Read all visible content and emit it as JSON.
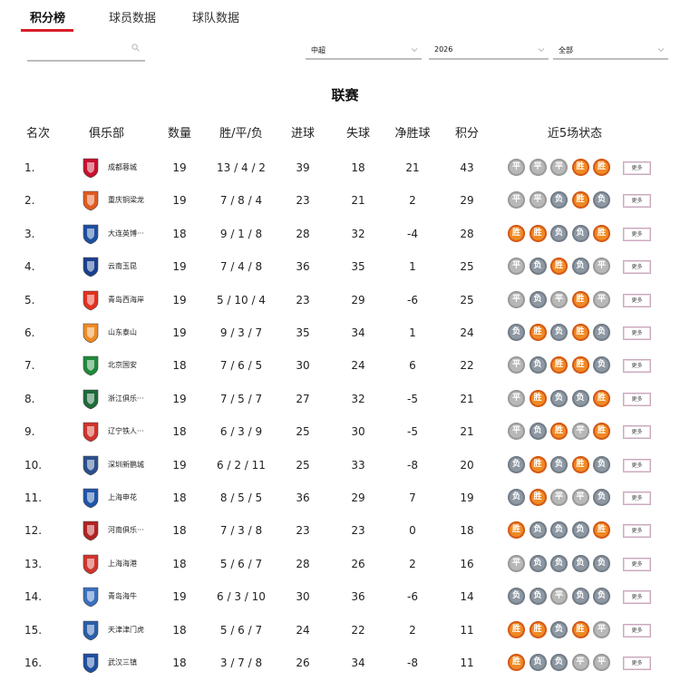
{
  "tabs": [
    {
      "label": "积分榜",
      "active": true
    },
    {
      "label": "球员数据",
      "active": false
    },
    {
      "label": "球队数据",
      "active": false
    }
  ],
  "search": {
    "placeholder": ""
  },
  "filters": {
    "league": "中超",
    "season": "2026",
    "scope": "全部"
  },
  "section_title": "联赛",
  "table": {
    "headers": [
      "名次",
      "俱乐部",
      "数量",
      "胜/平/负",
      "进球",
      "失球",
      "净胜球",
      "积分",
      "近5场状态"
    ],
    "more_label": "更多",
    "rows": [
      {
        "rank": "1.",
        "club": "成都蓉城",
        "games": "19",
        "wdl": "13 / 4 / 2",
        "gf": "39",
        "ga": "18",
        "gd": "21",
        "pts": "43",
        "form": [
          "平",
          "平",
          "平",
          "胜",
          "胜"
        ],
        "logo_color": "#c8102e"
      },
      {
        "rank": "2.",
        "club": "重庆铜梁龙",
        "games": "19",
        "wdl": "7 / 8 / 4",
        "gf": "23",
        "ga": "21",
        "gd": "2",
        "pts": "29",
        "form": [
          "平",
          "平",
          "负",
          "胜",
          "负"
        ],
        "logo_color": "#e05a1f"
      },
      {
        "rank": "3.",
        "club": "大连英博···",
        "games": "18",
        "wdl": "9 / 1 / 8",
        "gf": "28",
        "ga": "32",
        "gd": "-4",
        "pts": "28",
        "form": [
          "胜",
          "胜",
          "负",
          "负",
          "胜"
        ],
        "logo_color": "#1c4fa0"
      },
      {
        "rank": "4.",
        "club": "云南玉昆",
        "games": "19",
        "wdl": "7 / 4 / 8",
        "gf": "36",
        "ga": "35",
        "gd": "1",
        "pts": "25",
        "form": [
          "平",
          "负",
          "胜",
          "负",
          "平"
        ],
        "logo_color": "#1a3f8f"
      },
      {
        "rank": "5.",
        "club": "青岛西海岸",
        "games": "19",
        "wdl": "5 / 10 / 4",
        "gf": "23",
        "ga": "29",
        "gd": "-6",
        "pts": "25",
        "form": [
          "平",
          "负",
          "平",
          "胜",
          "平"
        ],
        "logo_color": "#e2321f"
      },
      {
        "rank": "6.",
        "club": "山东泰山",
        "games": "19",
        "wdl": "9 / 3 / 7",
        "gf": "35",
        "ga": "34",
        "gd": "1",
        "pts": "24",
        "form": [
          "负",
          "胜",
          "负",
          "胜",
          "负"
        ],
        "logo_color": "#f08a24"
      },
      {
        "rank": "7.",
        "club": "北京国安",
        "games": "18",
        "wdl": "7 / 6 / 5",
        "gf": "30",
        "ga": "24",
        "gd": "6",
        "pts": "22",
        "form": [
          "平",
          "负",
          "胜",
          "胜",
          "负"
        ],
        "logo_color": "#1f8a3a"
      },
      {
        "rank": "8.",
        "club": "浙江俱乐···",
        "games": "19",
        "wdl": "7 / 5 / 7",
        "gf": "27",
        "ga": "32",
        "gd": "-5",
        "pts": "21",
        "form": [
          "平",
          "胜",
          "负",
          "负",
          "胜"
        ],
        "logo_color": "#1e6b3a"
      },
      {
        "rank": "9.",
        "club": "辽宁铁人···",
        "games": "18",
        "wdl": "6 / 3 / 9",
        "gf": "25",
        "ga": "30",
        "gd": "-5",
        "pts": "21",
        "form": [
          "平",
          "负",
          "胜",
          "平",
          "胜"
        ],
        "logo_color": "#d0342c"
      },
      {
        "rank": "10.",
        "club": "深圳新鹏城",
        "games": "19",
        "wdl": "6 / 2 / 11",
        "gf": "25",
        "ga": "33",
        "gd": "-8",
        "pts": "20",
        "form": [
          "负",
          "胜",
          "负",
          "胜",
          "负"
        ],
        "logo_color": "#2a4f8c"
      },
      {
        "rank": "11.",
        "club": "上海申花",
        "games": "18",
        "wdl": "8 / 5 / 5",
        "gf": "36",
        "ga": "29",
        "gd": "7",
        "pts": "19",
        "form": [
          "负",
          "胜",
          "平",
          "平",
          "负"
        ],
        "logo_color": "#1f55a8"
      },
      {
        "rank": "12.",
        "club": "河南俱乐···",
        "games": "18",
        "wdl": "7 / 3 / 8",
        "gf": "23",
        "ga": "23",
        "gd": "0",
        "pts": "18",
        "form": [
          "胜",
          "负",
          "负",
          "负",
          "胜"
        ],
        "logo_color": "#b22222"
      },
      {
        "rank": "13.",
        "club": "上海海港",
        "games": "18",
        "wdl": "5 / 6 / 7",
        "gf": "28",
        "ga": "26",
        "gd": "2",
        "pts": "16",
        "form": [
          "平",
          "负",
          "负",
          "负",
          "负"
        ],
        "logo_color": "#d0342c"
      },
      {
        "rank": "14.",
        "club": "青岛海牛",
        "games": "19",
        "wdl": "6 / 3 / 10",
        "gf": "30",
        "ga": "36",
        "gd": "-6",
        "pts": "14",
        "form": [
          "负",
          "负",
          "平",
          "负",
          "负"
        ],
        "logo_color": "#3a6fbf"
      },
      {
        "rank": "15.",
        "club": "天津津门虎",
        "games": "18",
        "wdl": "5 / 6 / 7",
        "gf": "24",
        "ga": "22",
        "gd": "2",
        "pts": "11",
        "form": [
          "胜",
          "胜",
          "负",
          "胜",
          "平"
        ],
        "logo_color": "#2a5ea8"
      },
      {
        "rank": "16.",
        "club": "武汉三镇",
        "games": "18",
        "wdl": "3 / 7 / 8",
        "gf": "26",
        "ga": "34",
        "gd": "-8",
        "pts": "11",
        "form": [
          "胜",
          "负",
          "负",
          "平",
          "平"
        ],
        "logo_color": "#1f4fa0"
      }
    ]
  },
  "colors": {
    "accent": "#d81e2a",
    "win": "#f08a24",
    "draw": "#b8b8b8",
    "loss": "#8e98a3"
  },
  "icons": {
    "search": "search-icon",
    "dropdown": "chevron-down-icon",
    "club_logo": "club-logo-icon"
  }
}
